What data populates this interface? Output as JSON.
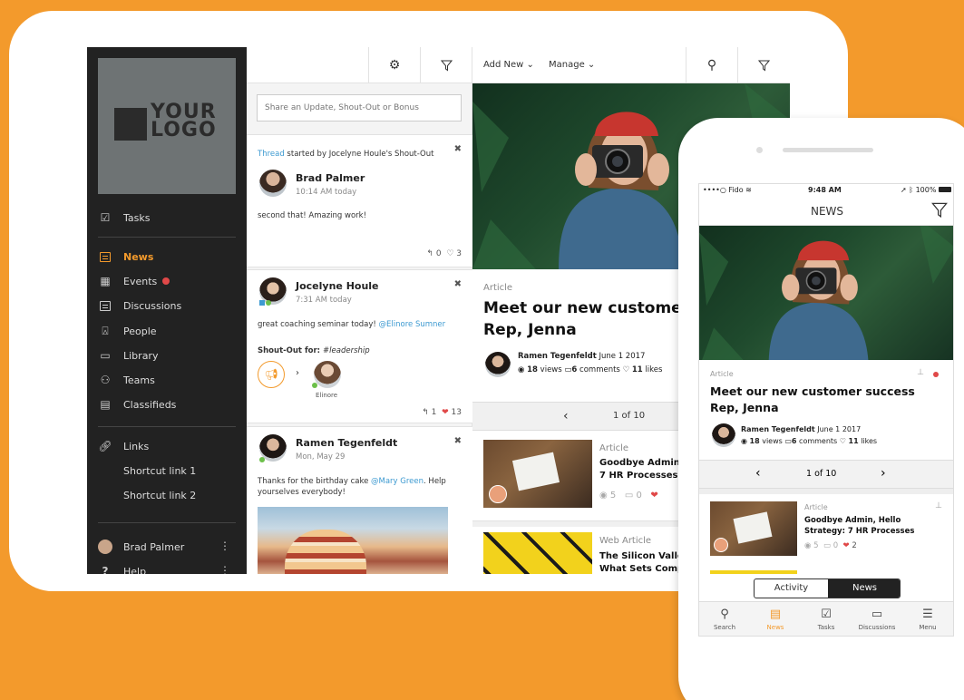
{
  "logo": {
    "line1": "YOUR",
    "line2": "LOGO"
  },
  "sidebar": {
    "items": [
      {
        "label": "Tasks"
      },
      {
        "label": "News"
      },
      {
        "label": "Events"
      },
      {
        "label": "Discussions"
      },
      {
        "label": "People"
      },
      {
        "label": "Library"
      },
      {
        "label": "Teams"
      },
      {
        "label": "Classifieds"
      },
      {
        "label": "Links"
      },
      {
        "label": "Shortcut link 1"
      },
      {
        "label": "Shortcut link 2"
      }
    ],
    "user": "Brad Palmer",
    "help": "Help"
  },
  "feed": {
    "share_placeholder": "Share an Update, Shout-Out or Bonus",
    "cards": [
      {
        "thread_link": "Thread",
        "thread_text": " started by Jocelyne Houle's Shout-Out",
        "name": "Brad Palmer",
        "time": "10:14 AM today",
        "body": "second that! Amazing work!",
        "replies": "0",
        "likes": "3"
      },
      {
        "name": "Jocelyne Houle",
        "time": "7:31 AM today",
        "body": "great coaching seminar today! ",
        "mention": "@Elinore Sumner",
        "shout_label": "Shout-Out for: ",
        "shout_tag": "#leadership",
        "recipient": "Elinore",
        "replies": "1",
        "likes": "13"
      },
      {
        "name": "Ramen Tegenfeldt",
        "time": "Mon, May 29",
        "body": "Thanks for the birthday cake ",
        "mention": "@Mary Green",
        "body2": ". Help yourselves everybody!"
      }
    ]
  },
  "article_toolbar": {
    "add_new": "Add New",
    "manage": "Manage"
  },
  "article": {
    "type": "Article",
    "title": "Meet our new customer s",
    "title2": "Rep, Jenna",
    "author": "Ramen Tegenfeldt",
    "date": "June 1 2017",
    "views_num": "18",
    "views": "views",
    "comments_num": "6",
    "comments": "comments",
    "likes_num": "11",
    "likes": "likes"
  },
  "pager": {
    "text": "1 of 10"
  },
  "article_list": [
    {
      "type": "Article",
      "title1": "Goodbye Admin, ",
      "title2": "7 HR Processes Th",
      "views": "5",
      "comments": "0"
    },
    {
      "type": "Web Article",
      "title1": "The Silicon Valley",
      "title2": "What Sets Compa"
    }
  ],
  "phone": {
    "carrier": "••••○ Fido",
    "time": "9:48 AM",
    "battery": "100%",
    "header": "NEWS",
    "article": {
      "type": "Article",
      "title1": "Meet our new customer success",
      "title2": "Rep, Jenna",
      "author": "Ramen Tegenfeldt",
      "date": "June 1 2017",
      "views_num": "18",
      "views": "views",
      "comments_num": "6",
      "comments": "comments",
      "likes_num": "11",
      "likes": "likes"
    },
    "pager": "1 of 10",
    "list_item": {
      "type": "Article",
      "title1": "Goodbye Admin, Hello",
      "title2": "Strategy: 7 HR Processes",
      "views": "5",
      "comments": "0",
      "likes": "2"
    },
    "toggle": {
      "left": "Activity",
      "right": "News"
    },
    "tabs": [
      {
        "label": "Search"
      },
      {
        "label": "News"
      },
      {
        "label": "Tasks"
      },
      {
        "label": "Discussions"
      },
      {
        "label": "Menu"
      }
    ]
  },
  "colors": {
    "accent": "#f39a2c",
    "link": "#3d9ad1",
    "alert": "#e04848",
    "sidebar": "#222222"
  }
}
